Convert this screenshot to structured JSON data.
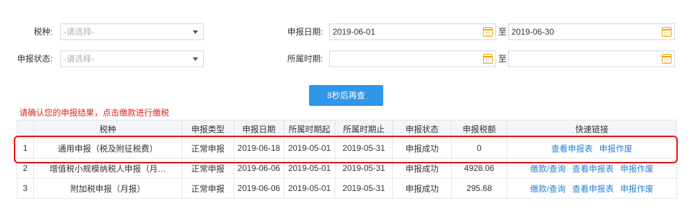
{
  "form": {
    "tax_type": {
      "label": "税种:",
      "placeholder": "-请选择-"
    },
    "status": {
      "label": "申报状态:",
      "placeholder": "-请选择-"
    },
    "declare_date": {
      "label": "申报日期:",
      "start": "2019-06-01",
      "to": "至",
      "end": "2019-06-30"
    },
    "period": {
      "label": "所属时期:",
      "start": "",
      "to": "至",
      "end": ""
    }
  },
  "query_button": "8秒后再查",
  "hint": "请确认您的申报结果，点击缴款进行缴税",
  "table": {
    "headers": [
      "",
      "税种",
      "申报类型",
      "申报日期",
      "所属时期起",
      "所属时期止",
      "申报状态",
      "申报税额",
      "快速链接"
    ],
    "rows": [
      {
        "idx": "1",
        "tax": "通用申报（税及附征税费）",
        "type": "正常申报",
        "date": "2019-06-18",
        "start": "2019-05-01",
        "end": "2019-05-31",
        "status": "成功",
        "status_full": "申报成功",
        "amount": "0",
        "links": [
          "查看申报表",
          "申报作废"
        ]
      },
      {
        "idx": "2",
        "tax": "增值税小规模纳税人申报（月…",
        "type": "正常申报",
        "date": "2019-06-06",
        "start": "2019-05-01",
        "end": "2019-05-31",
        "status_full": "申报成功",
        "amount": "4928.06",
        "links": [
          "缴款/查询",
          "查看申报表",
          "申报作废"
        ]
      },
      {
        "idx": "3",
        "tax": "附加税申报（月报）",
        "type": "正常申报",
        "date": "2019-06-06",
        "start": "2019-05-01",
        "end": "2019-05-31",
        "status_full": "申报成功",
        "amount": "295.68",
        "links": [
          "缴款/查询",
          "查看申报表",
          "申报作废"
        ]
      }
    ]
  },
  "colors": {
    "primary": "#2f96e8",
    "link": "#2a7fd4",
    "warning": "#e02020",
    "calendar": "#f0a000"
  },
  "icons": {
    "calendar": "calendar-icon",
    "dropdown": "chevron-down-icon"
  }
}
